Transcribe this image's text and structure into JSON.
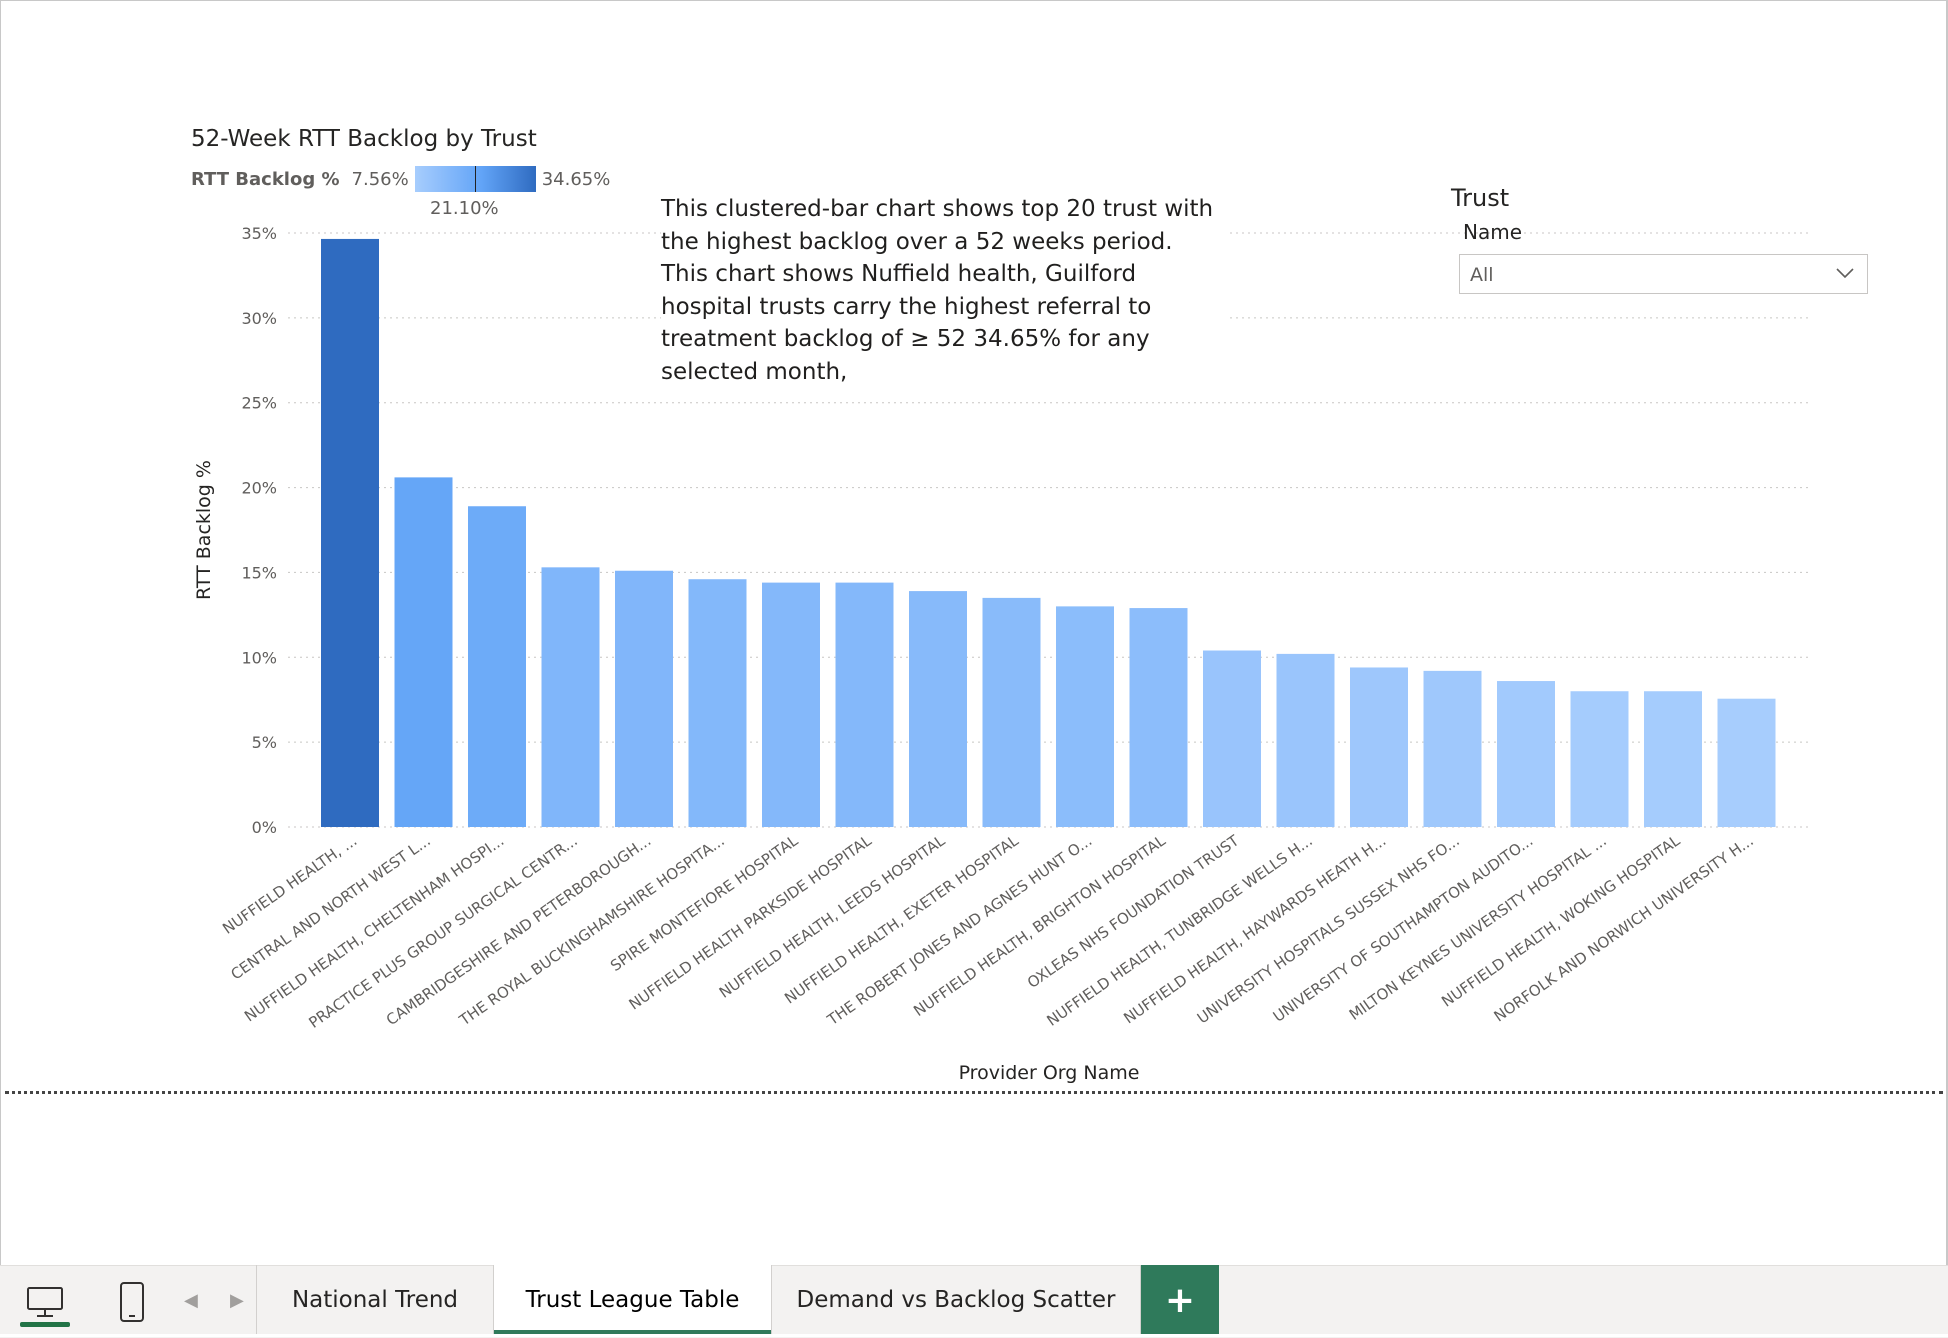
{
  "chart": {
    "title": "52-Week RTT Backlog by Trust",
    "legend": {
      "label": "RTT Backlog %",
      "min": "7.56%",
      "mid": "21.10%",
      "max": "34.65%"
    },
    "annotation": "This clustered-bar chart shows top 20 trust with the highest backlog over a 52 weeks period. This chart shows Nuffield health, Guilford hospital trusts carry the highest referral to treatment backlog of  ≥ 52 34.65% for any selected month,"
  },
  "chart_data": {
    "type": "bar",
    "xlabel": "Provider Org Name",
    "ylabel": "RTT Backlog %",
    "ylim": [
      0,
      35
    ],
    "yticks": [
      "0%",
      "5%",
      "10%",
      "15%",
      "20%",
      "25%",
      "30%",
      "35%"
    ],
    "grid": true,
    "categories": [
      "NUFFIELD HEALTH, ...",
      "CENTRAL AND NORTH WEST L...",
      "NUFFIELD HEALTH, CHELTENHAM HOSPI...",
      "PRACTICE PLUS GROUP SURGICAL CENTR...",
      "CAMBRIDGESHIRE AND PETERBOROUGH...",
      "THE ROYAL BUCKINGHAMSHIRE HOSPITA...",
      "SPIRE MONTEFIORE HOSPITAL",
      "NUFFIELD HEALTH PARKSIDE HOSPITAL",
      "NUFFIELD HEALTH, LEEDS HOSPITAL",
      "NUFFIELD HEALTH, EXETER HOSPITAL",
      "THE ROBERT JONES AND AGNES HUNT O...",
      "NUFFIELD HEALTH, BRIGHTON HOSPITAL",
      "OXLEAS NHS FOUNDATION TRUST",
      "NUFFIELD HEALTH, TUNBRIDGE WELLS H...",
      "NUFFIELD HEALTH, HAYWARDS HEATH H...",
      "UNIVERSITY HOSPITALS SUSSEX NHS FO...",
      "UNIVERSITY OF SOUTHAMPTON AUDITO...",
      "MILTON KEYNES UNIVERSITY HOSPITAL ...",
      "NUFFIELD HEALTH, WOKING HOSPITAL",
      "NORFOLK AND NORWICH UNIVERSITY H..."
    ],
    "values": [
      34.65,
      20.6,
      18.9,
      15.3,
      15.1,
      14.6,
      14.4,
      14.4,
      13.9,
      13.5,
      13.0,
      12.9,
      10.4,
      10.2,
      9.4,
      9.2,
      8.6,
      8.0,
      8.0,
      7.56
    ],
    "color_scale": {
      "min": "#a7cdfd",
      "mid": "#62a4f7",
      "max": "#2f6bc0"
    }
  },
  "slicer": {
    "title": "Trust",
    "field_label": "Name",
    "value": "All",
    "icon": "chevron-down-icon"
  },
  "tabs": [
    {
      "label": "National Trend",
      "active": false
    },
    {
      "label": "Trust League Table",
      "active": true
    },
    {
      "label": "Demand vs Backlog Scatter",
      "active": false
    }
  ],
  "add_tab": {
    "label": "+"
  },
  "view_icons": [
    "desktop-view-icon",
    "mobile-view-icon"
  ],
  "nav_icons": [
    "chevron-left-icon",
    "chevron-right-icon"
  ]
}
